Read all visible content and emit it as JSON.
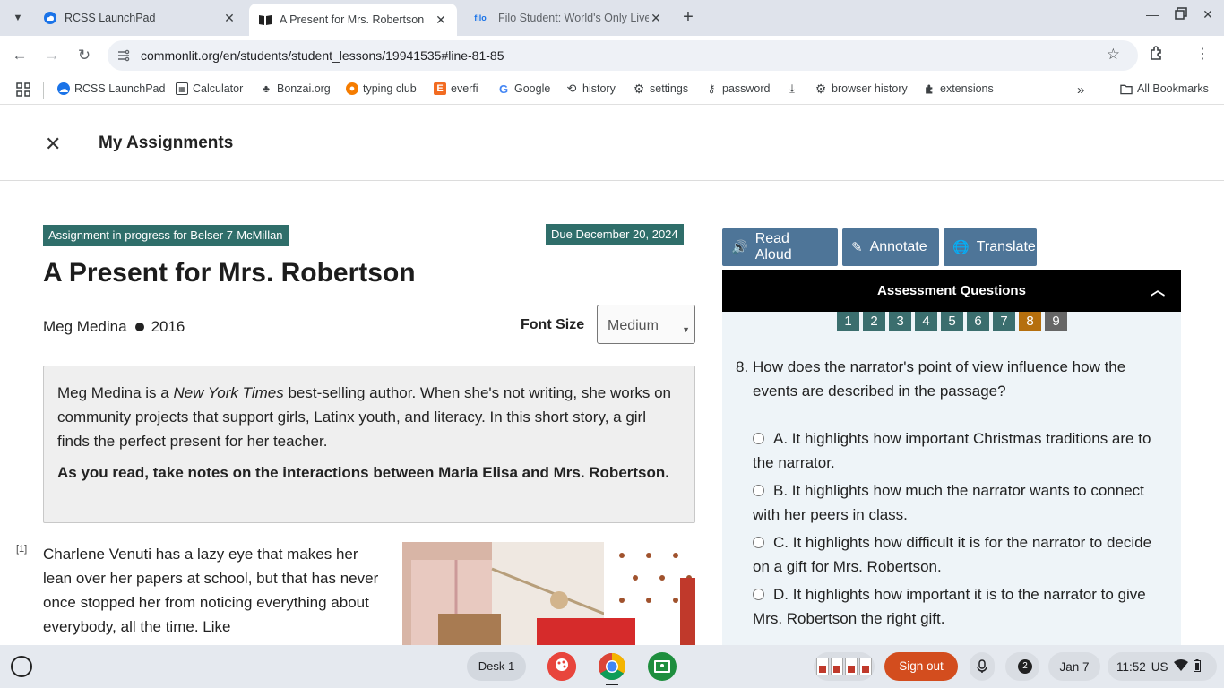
{
  "tabs": [
    {
      "title": "RCSS LaunchPad",
      "favicon": "cloud-icon",
      "active": false
    },
    {
      "title": "A Present for Mrs. Robertson",
      "favicon": "book-icon",
      "active": true
    },
    {
      "title": "Filo Student: World's Only Live I",
      "favicon": "filo-icon",
      "active": false
    }
  ],
  "tab_favicon_text": {
    "filo": "filo"
  },
  "address": {
    "url": "commonlit.org/en/students/student_lessons/19941535#line-81-85"
  },
  "bookmarks": [
    {
      "label": "RCSS LaunchPad",
      "icon": "cloud-icon"
    },
    {
      "label": "Calculator",
      "icon": "calculator-icon"
    },
    {
      "label": "Bonzai.org",
      "icon": "bonzai-icon"
    },
    {
      "label": "typing club",
      "icon": "typingclub-icon"
    },
    {
      "label": "everfi",
      "icon": "everfi-icon"
    },
    {
      "label": "Google",
      "icon": "google-icon"
    },
    {
      "label": "history",
      "icon": "history-icon"
    },
    {
      "label": "settings",
      "icon": "gear-icon"
    },
    {
      "label": "password",
      "icon": "key-icon"
    },
    {
      "label": "",
      "icon": "download-icon"
    },
    {
      "label": "browser history",
      "icon": "gear-icon"
    },
    {
      "label": "extensions",
      "icon": "puzzle-icon"
    }
  ],
  "all_bookmarks": "All Bookmarks",
  "header": {
    "title": "My Assignments"
  },
  "lesson": {
    "status_badge": "Assignment in progress for Belser 7-McMillan",
    "due_badge": "Due December 20, 2024",
    "title": "A Present for Mrs. Robertson",
    "author": "Meg Medina",
    "year": "2016",
    "font_size_label": "Font Size",
    "font_size_value": "Medium",
    "intro_pre": "Meg Medina is a ",
    "intro_italic": "New York Times",
    "intro_post": " best-selling author. When she's not writing, she works on community projects that support girls, Latinx youth, and literacy. In this short story, a girl finds the perfect present for her teacher.",
    "intro_bold": "As you read, take notes on the interactions between Maria Elisa and Mrs. Robertson.",
    "para_num": "[1]",
    "para_text": "Charlene Venuti has a lazy eye that makes her lean over her papers at school, but that has never once stopped her from noticing everything about everybody, all the time. Like"
  },
  "tools": {
    "read_aloud": "Read Aloud",
    "annotate": "Annotate",
    "translate": "Translate"
  },
  "assessment": {
    "header": "Assessment Questions",
    "question_numbers": [
      "1",
      "2",
      "3",
      "4",
      "5",
      "6",
      "7",
      "8",
      "9"
    ],
    "current": "8",
    "question_num": "8.",
    "question_text": "How does the narrator's point of view influence how the events are described in the passage?",
    "options": [
      "A. It highlights how important Christmas traditions are to the narrator.",
      "B. It highlights how much the narrator wants to connect with her peers in class.",
      "C. It highlights how difficult it is for the narrator to decide on a gift for Mrs. Robertson.",
      "D. It highlights how important it is to the narrator to give Mrs. Robertson the right gift."
    ]
  },
  "shelf": {
    "desk": "Desk 1",
    "sign_out": "Sign out",
    "notifications": "2",
    "date": "Jan 7",
    "time": "11:52",
    "locale": "US"
  },
  "colors": {
    "teal_badge": "#2f6e6a",
    "tool_button": "#4e7598",
    "current_question": "#b56f0e",
    "sign_out": "#d34d1e"
  }
}
